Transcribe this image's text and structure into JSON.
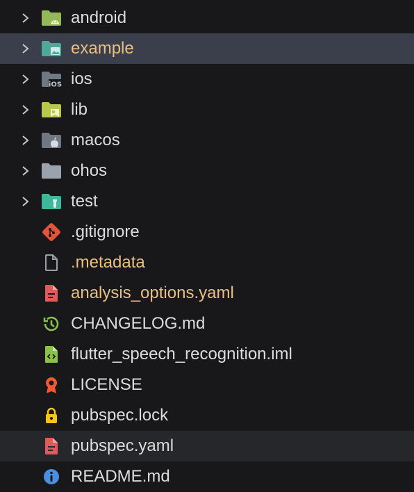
{
  "explorer": {
    "items": [
      {
        "label": "android",
        "kind": "folder",
        "icon": "folder-android-icon",
        "modified": false
      },
      {
        "label": "example",
        "kind": "folder",
        "icon": "folder-example-icon",
        "modified": true,
        "selected": true
      },
      {
        "label": "ios",
        "kind": "folder",
        "icon": "folder-ios-icon",
        "modified": false
      },
      {
        "label": "lib",
        "kind": "folder",
        "icon": "folder-lib-icon",
        "modified": false
      },
      {
        "label": "macos",
        "kind": "folder",
        "icon": "folder-macos-icon",
        "modified": false
      },
      {
        "label": "ohos",
        "kind": "folder",
        "icon": "folder-icon",
        "modified": false
      },
      {
        "label": "test",
        "kind": "folder",
        "icon": "folder-test-icon",
        "modified": false
      },
      {
        "label": ".gitignore",
        "kind": "file",
        "icon": "git-icon",
        "modified": false
      },
      {
        "label": ".metadata",
        "kind": "file",
        "icon": "file-icon",
        "modified": true
      },
      {
        "label": "analysis_options.yaml",
        "kind": "file",
        "icon": "yaml-icon",
        "modified": true
      },
      {
        "label": "CHANGELOG.md",
        "kind": "file",
        "icon": "changelog-icon",
        "modified": false
      },
      {
        "label": "flutter_speech_recognition.iml",
        "kind": "file",
        "icon": "iml-file-icon",
        "modified": false
      },
      {
        "label": "LICENSE",
        "kind": "file",
        "icon": "license-icon",
        "modified": false
      },
      {
        "label": "pubspec.lock",
        "kind": "file",
        "icon": "lock-icon",
        "modified": false
      },
      {
        "label": "pubspec.yaml",
        "kind": "file",
        "icon": "yaml-icon",
        "modified": false,
        "hover": true
      },
      {
        "label": "README.md",
        "kind": "file",
        "icon": "info-icon",
        "modified": false
      }
    ]
  },
  "colors": {
    "background": "#18181b",
    "selected_row": "#3a3f4b",
    "hover_row": "#26272b",
    "text": "#dcdcdc",
    "modified_text": "#e8bf85"
  }
}
